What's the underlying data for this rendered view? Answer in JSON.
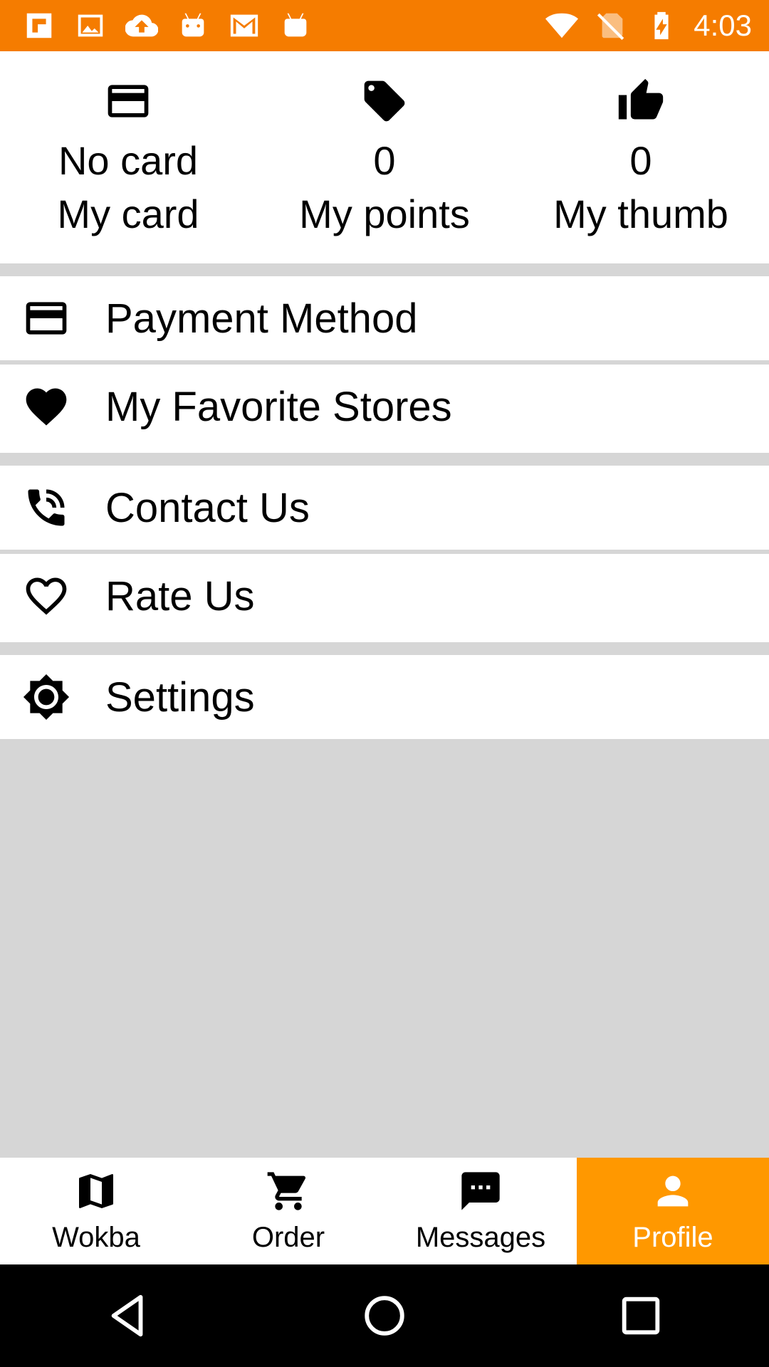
{
  "status_bar": {
    "time": "4:03",
    "left_icons": [
      "flipboard-icon",
      "image-icon",
      "cloud-upload-icon",
      "android-icon",
      "gmail-icon",
      "android-icon"
    ],
    "right_icons": [
      "wifi-icon",
      "no-sim-icon",
      "battery-charging-icon"
    ],
    "color": "#F57C00"
  },
  "stats": [
    {
      "icon": "credit-card-icon",
      "value": "No card",
      "label": "My card"
    },
    {
      "icon": "tag-icon",
      "value": "0",
      "label": "My points"
    },
    {
      "icon": "thumb-up-icon",
      "value": "0",
      "label": "My thumb"
    }
  ],
  "menu": [
    {
      "icon": "credit-card-icon",
      "label": "Payment Method"
    },
    {
      "icon": "heart-icon",
      "label": "My Favorite Stores"
    },
    {
      "icon": "phone-icon",
      "label": "Contact Us"
    },
    {
      "icon": "heart-outline-icon",
      "label": "Rate Us"
    },
    {
      "icon": "brightness-icon",
      "label": "Settings"
    }
  ],
  "bottom_nav": [
    {
      "icon": "map-icon",
      "label": "Wokba",
      "active": false
    },
    {
      "icon": "cart-icon",
      "label": "Order",
      "active": false
    },
    {
      "icon": "message-icon",
      "label": "Messages",
      "active": false
    },
    {
      "icon": "person-icon",
      "label": "Profile",
      "active": true
    }
  ],
  "accent_color": "#FF9800",
  "system_nav": [
    "back-icon",
    "home-icon",
    "recents-icon"
  ]
}
